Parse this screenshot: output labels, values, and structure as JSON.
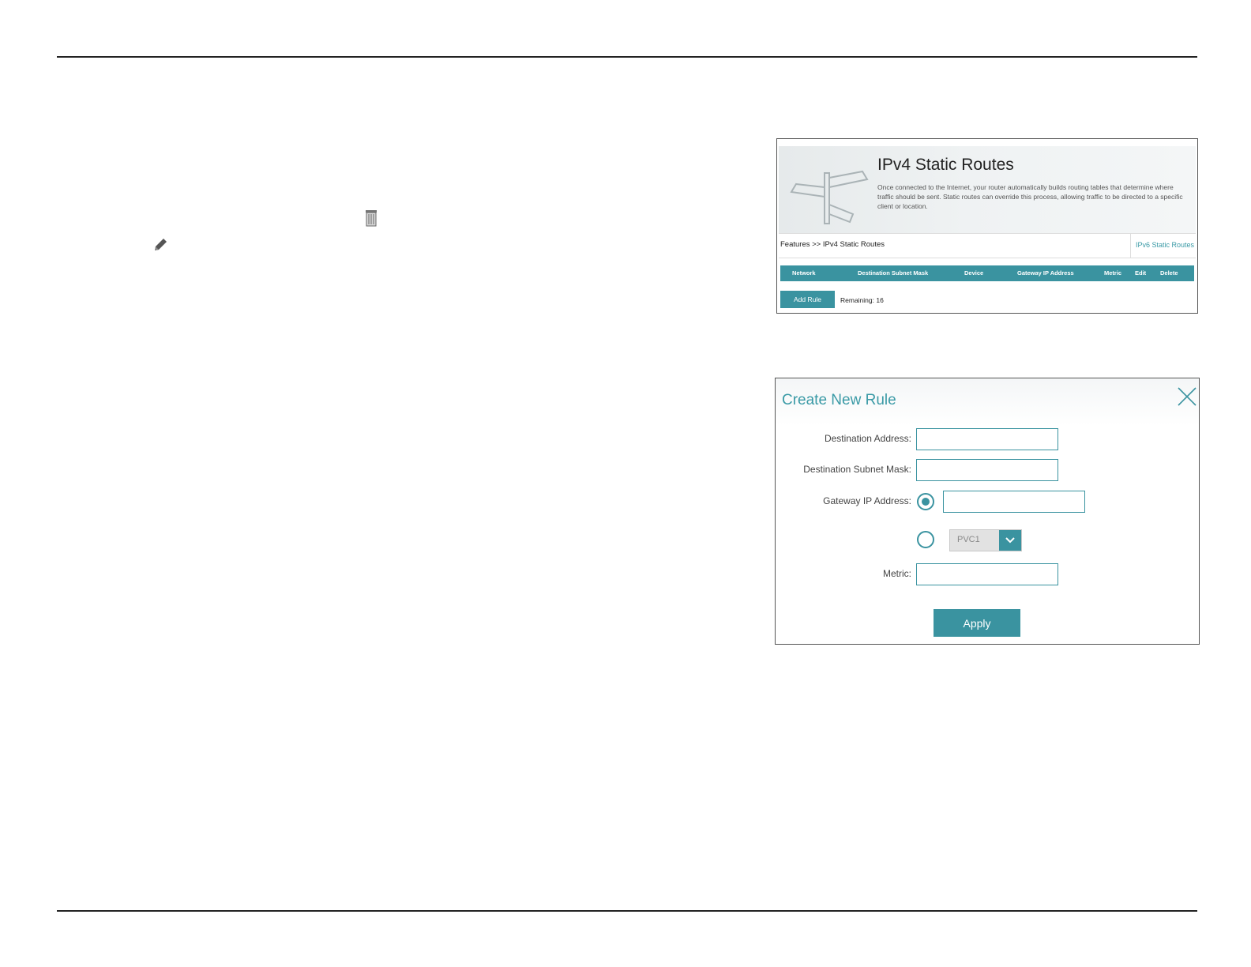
{
  "routes_panel": {
    "title": "IPv4 Static Routes",
    "description": "Once connected to the Internet, your router automatically builds routing tables that determine where traffic should be sent. Static routes can override this process, allowing traffic to be directed to a specific client or location.",
    "breadcrumb": "Features >> IPv4 Static Routes",
    "ipv6_link": "IPv6 Static Routes",
    "columns": [
      "Network",
      "Destination Subnet Mask",
      "Device",
      "Gateway IP Address",
      "Metric",
      "Edit",
      "Delete"
    ],
    "add_rule_label": "Add Rule",
    "remaining_text": "Remaining: 16"
  },
  "create_rule": {
    "title": "Create New Rule",
    "destination_address_label": "Destination Address:",
    "destination_address_value": "",
    "subnet_mask_label": "Destination Subnet Mask:",
    "subnet_mask_value": "",
    "gateway_label": "Gateway IP Address:",
    "gateway_value": "",
    "gateway_option_ip_selected": true,
    "interface_selected": "PVC1",
    "metric_label": "Metric:",
    "metric_value": "",
    "apply_label": "Apply"
  },
  "colors": {
    "accent": "#3a93a0",
    "link": "#3a9aa6"
  },
  "icons": [
    "trash-icon",
    "pencil-icon",
    "signpost-icon",
    "close-icon",
    "chevron-down-icon"
  ]
}
